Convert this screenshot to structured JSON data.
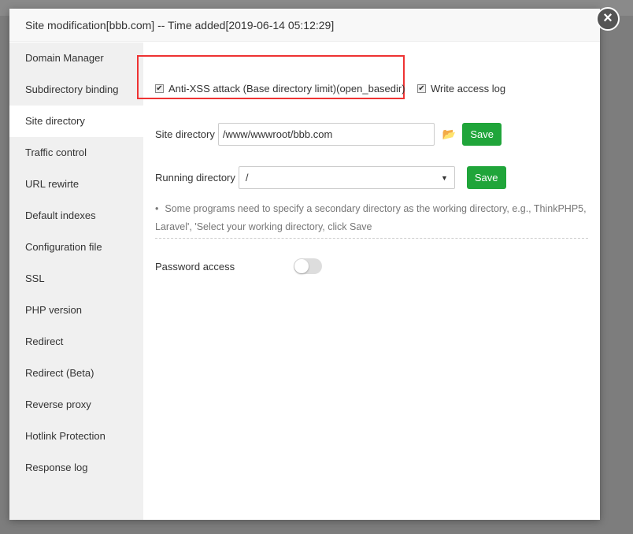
{
  "header": {
    "title": "Site modification[bbb.com] -- Time added[2019-06-14 05:12:29]"
  },
  "sidebar": {
    "items": [
      {
        "label": "Domain Manager"
      },
      {
        "label": "Subdirectory binding"
      },
      {
        "label": "Site directory"
      },
      {
        "label": "Traffic control"
      },
      {
        "label": "URL rewirte"
      },
      {
        "label": "Default indexes"
      },
      {
        "label": "Configuration file"
      },
      {
        "label": "SSL"
      },
      {
        "label": "PHP version"
      },
      {
        "label": "Redirect"
      },
      {
        "label": "Redirect (Beta)"
      },
      {
        "label": "Reverse proxy"
      },
      {
        "label": "Hotlink Protection"
      },
      {
        "label": "Response log"
      }
    ],
    "active": "Site directory"
  },
  "options": {
    "anti_xss": {
      "label": "Anti-XSS attack (Base directory limit)(open_basedir)",
      "checked": true
    },
    "access_log": {
      "label": "Write access log",
      "checked": true
    }
  },
  "site_dir": {
    "label": "Site directory",
    "value": "/www/wwwroot/bbb.com",
    "save": "Save"
  },
  "run_dir": {
    "label": "Running directory",
    "value": "/",
    "save": "Save"
  },
  "note": {
    "bullet": "•",
    "text": "Some programs need to specify a secondary directory as the working directory, e.g., ThinkPHP5, Laravel', 'Select your working directory, click Save"
  },
  "password": {
    "label": "Password access",
    "enabled": false
  },
  "colors": {
    "accent": "#20a53a",
    "highlight": "#e33333"
  }
}
